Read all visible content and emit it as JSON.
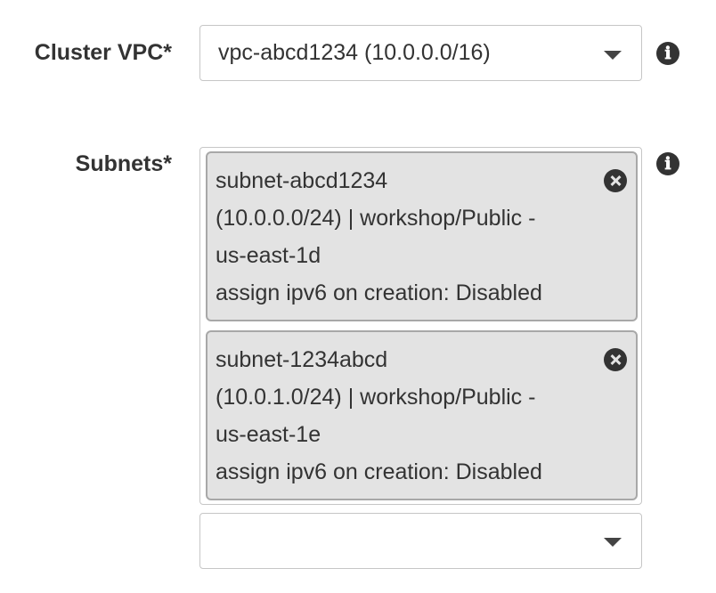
{
  "form": {
    "cluster_vpc": {
      "label": "Cluster VPC*",
      "selected_value": "vpc-abcd1234 (10.0.0.0/16)",
      "info_icon": "info-icon"
    },
    "subnets": {
      "label": "Subnets*",
      "info_icon": "info-icon",
      "selected": [
        {
          "line1": "subnet-abcd1234",
          "line2": "(10.0.0.0/24) | workshop/Public -",
          "line3": "us-east-1d",
          "line4": "assign ipv6 on creation: Disabled"
        },
        {
          "line1": "subnet-1234abcd",
          "line2": "(10.0.1.0/24) | workshop/Public -",
          "line3": "us-east-1e",
          "line4": "assign ipv6 on creation: Disabled"
        }
      ],
      "add_select_value": ""
    }
  },
  "icons": {
    "info": "ℹ",
    "remove": "close-circle-icon",
    "dropdown": "caret-down-icon"
  },
  "colors": {
    "label_text": "#333333",
    "token_background": "#e3e3e3",
    "token_border": "#a8a8a8",
    "field_border": "#c6c6c6"
  }
}
